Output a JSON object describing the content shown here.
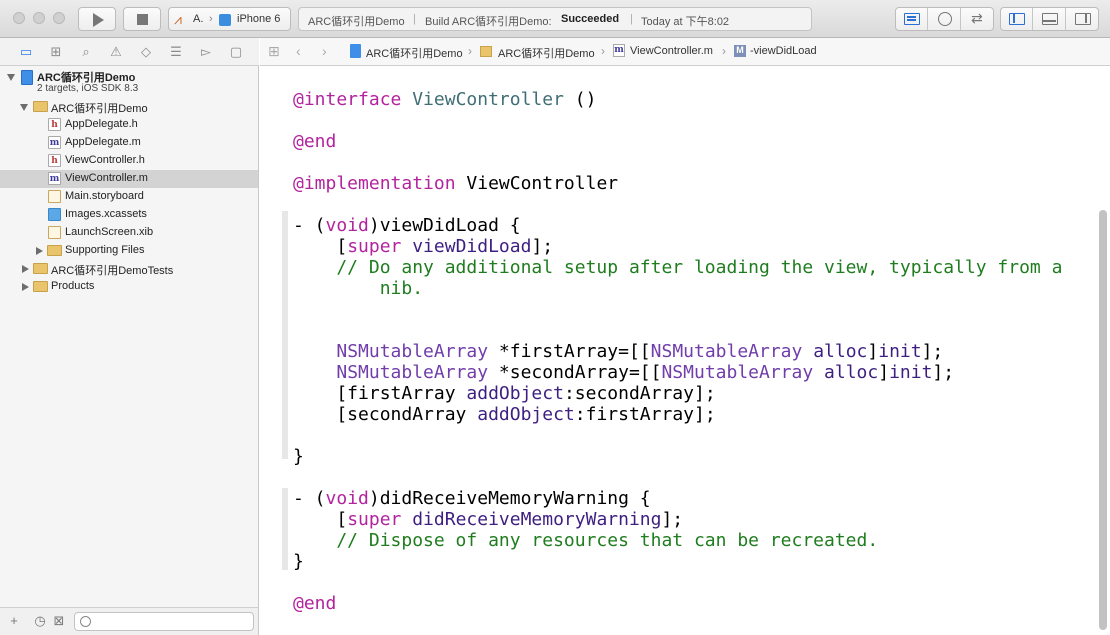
{
  "toolbar": {
    "scheme_target": "A.",
    "scheme_separator": "›",
    "scheme_device": "iPhone 6",
    "activity_project": "ARC循环引用Demo",
    "activity_build": "Build ARC循环引用Demo:",
    "activity_status": "Succeeded",
    "activity_time": "Today at 下午8:02"
  },
  "navigator": {
    "project_name": "ARC循环引用Demo",
    "project_sub": "2 targets, iOS SDK 8.3",
    "items": [
      {
        "label": "ARC循环引用Demo",
        "icon": "folder-icon"
      },
      {
        "label": "AppDelegate.h",
        "icon": "h-file-icon",
        "glyph": "h"
      },
      {
        "label": "AppDelegate.m",
        "icon": "m-file-icon",
        "glyph": "m"
      },
      {
        "label": "ViewController.h",
        "icon": "h-file-icon",
        "glyph": "h"
      },
      {
        "label": "ViewController.m",
        "icon": "m-file-icon",
        "glyph": "m"
      },
      {
        "label": "Main.storyboard",
        "icon": "storyboard-icon"
      },
      {
        "label": "Images.xcassets",
        "icon": "assets-icon"
      },
      {
        "label": "LaunchScreen.xib",
        "icon": "xib-icon"
      },
      {
        "label": "Supporting Files",
        "icon": "folder-icon"
      },
      {
        "label": "ARC循环引用DemoTests",
        "icon": "folder-icon"
      },
      {
        "label": "Products",
        "icon": "folder-icon"
      }
    ]
  },
  "jumpbar": {
    "crumbs": [
      "ARC循环引用Demo",
      "ARC循环引用Demo",
      "ViewController.m",
      "-viewDidLoad"
    ],
    "file_glyph": "m",
    "method_glyph": "M"
  },
  "code": {
    "l1_kw": "@interface",
    "l1_cls": "ViewController",
    "l1_rest": " ()",
    "l2_kw": "@end",
    "l3_kw": "@implementation",
    "l3_rest": " ViewController",
    "l4_a": "- (",
    "l4_kw": "void",
    "l4_b": ")viewDidLoad {",
    "l5_a": "    [",
    "l5_kw": "super",
    "l5_sp": " ",
    "l5_m": "viewDidLoad",
    "l5_b": "];",
    "l6_cmt": "    // Do any additional setup after loading the view, typically from a",
    "l7_cmt": "        nib.",
    "l8_typ": "NSMutableArray",
    "l8_a": " *firstArray=[[",
    "l8_typ2": "NSMutableArray",
    "l8_sp": " ",
    "l8_m": "alloc",
    "l8_b": "]",
    "l8_m2": "init",
    "l8_c": "];",
    "l9_typ": "NSMutableArray",
    "l9_a": " *secondArray=[[",
    "l9_typ2": "NSMutableArray",
    "l9_sp": " ",
    "l9_m": "alloc",
    "l9_b": "]",
    "l9_m2": "init",
    "l9_c": "];",
    "l10_a": "    [firstArray ",
    "l10_m": "addObject",
    "l10_b": ":secondArray];",
    "l11_a": "    [secondArray ",
    "l11_m": "addObject",
    "l11_b": ":firstArray];",
    "l12": "}",
    "l13_a": "- (",
    "l13_kw": "void",
    "l13_b": ")didReceiveMemoryWarning {",
    "l14_a": "    [",
    "l14_kw": "super",
    "l14_sp": " ",
    "l14_m": "didReceiveMemoryWarning",
    "l14_b": "];",
    "l15_cmt": "    // Dispose of any resources that can be recreated.",
    "l16": "}",
    "l17_kw": "@end"
  },
  "colors": {
    "keyword": "#b3239e",
    "class": "#3f6e74",
    "type": "#703daa",
    "method": "#3d1e81",
    "comment": "#1f7d1f",
    "selection": "#d3d3d3"
  }
}
